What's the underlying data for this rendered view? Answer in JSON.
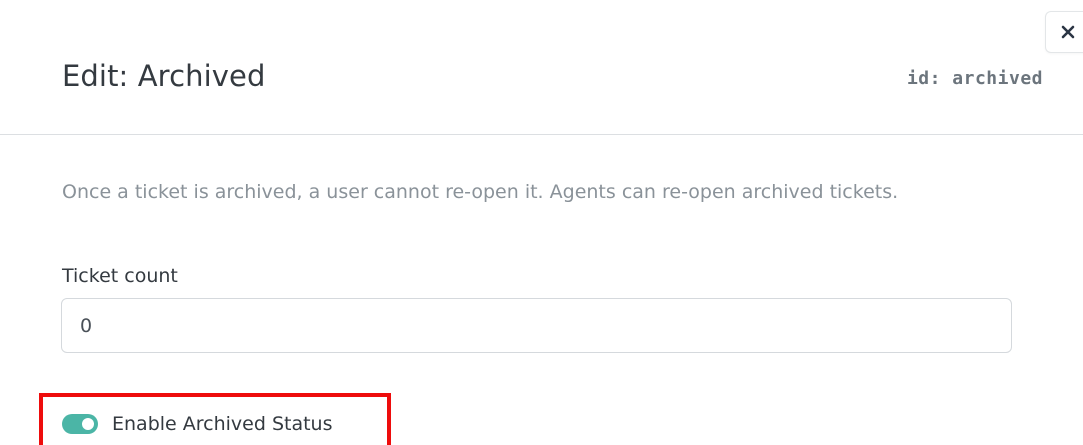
{
  "dialog": {
    "title": "Edit: Archived",
    "id_label": "id: archived",
    "close_icon": "close-icon"
  },
  "description": "Once a ticket is archived, a user cannot re-open it. Agents can re-open archived tickets.",
  "ticket_count": {
    "label": "Ticket count",
    "value": "0"
  },
  "toggle": {
    "label": "Enable Archived Status",
    "checked": true
  },
  "colors": {
    "accent": "#4bb5a6",
    "highlight": "#ee0c0c",
    "title_text": "#343a40",
    "muted_text": "#8a9299"
  }
}
